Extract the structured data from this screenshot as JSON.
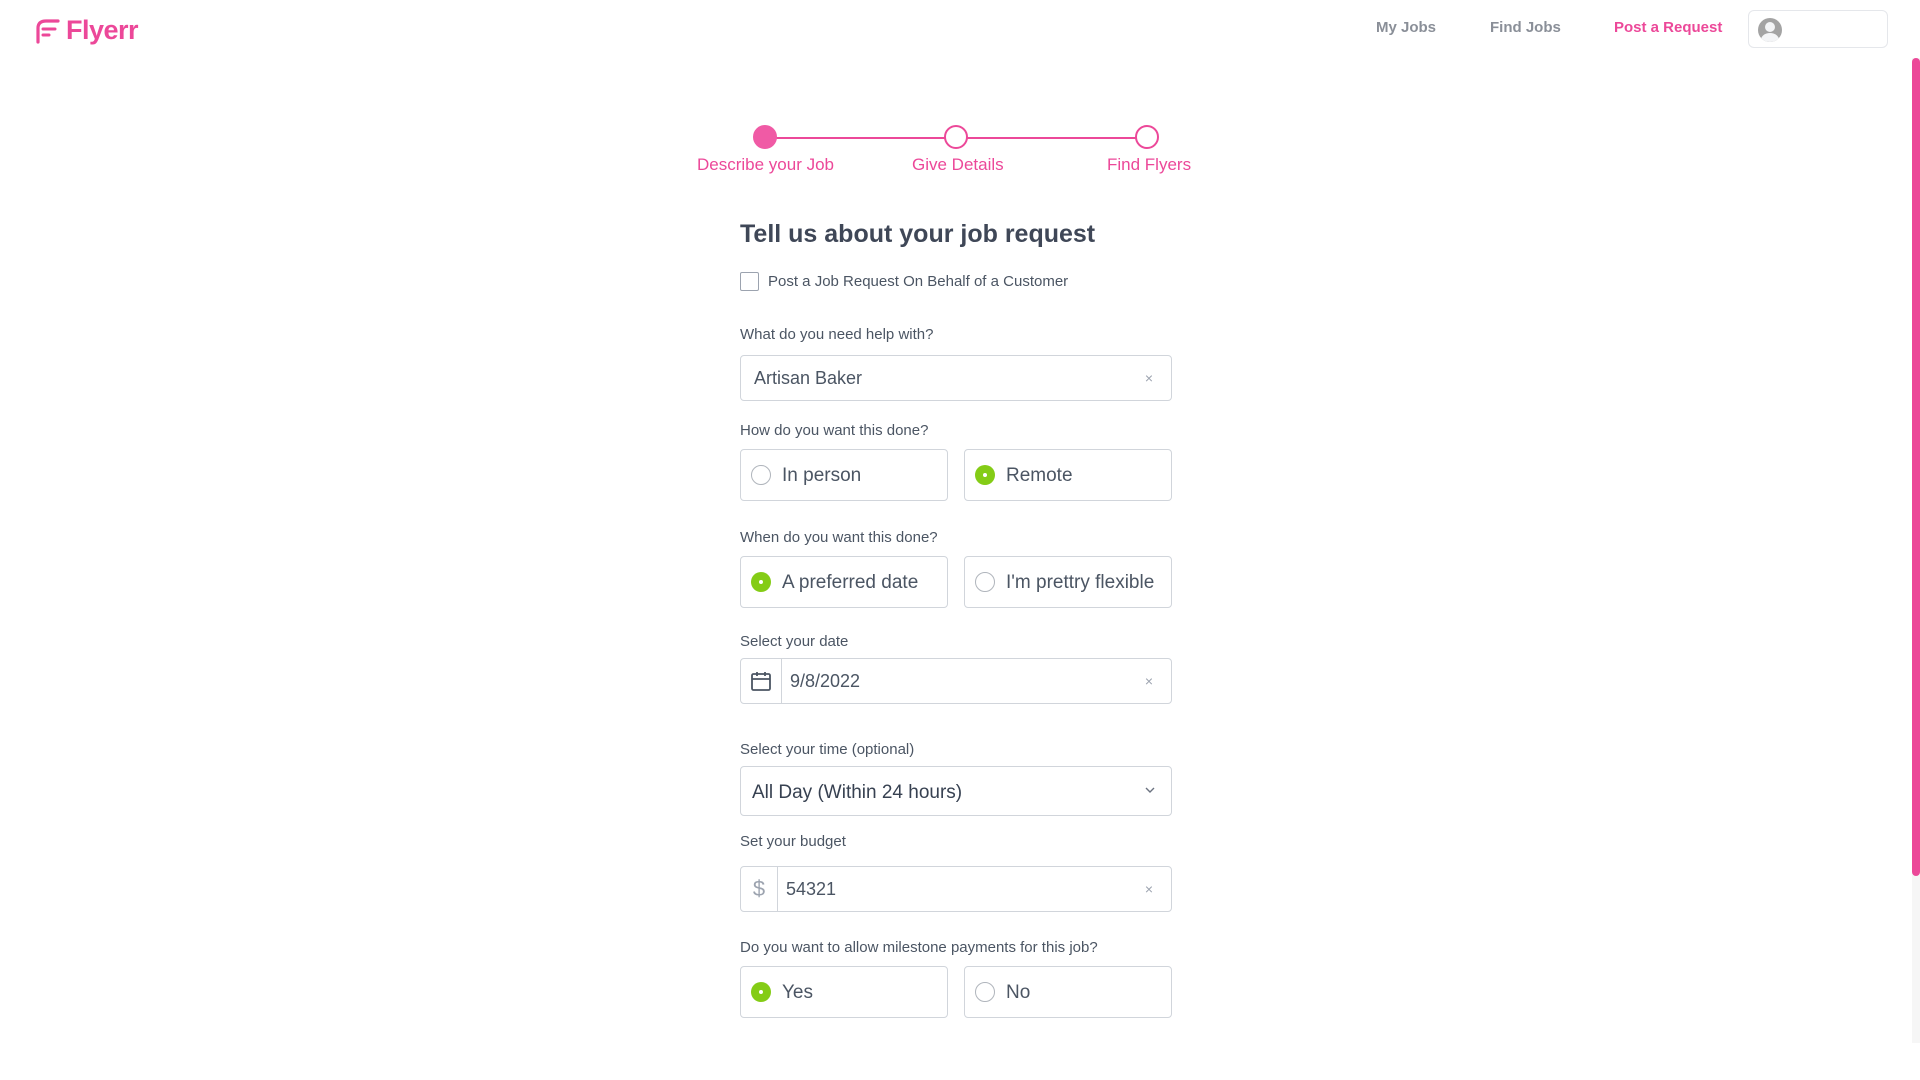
{
  "brand": {
    "name": "Flyerr",
    "color": "#ec4899"
  },
  "nav": {
    "my_jobs": "My Jobs",
    "find_jobs": "Find Jobs",
    "post_request": "Post a Request"
  },
  "steps": [
    {
      "label": "Describe your Job",
      "state": "active"
    },
    {
      "label": "Give Details",
      "state": "pending"
    },
    {
      "label": "Find Flyers",
      "state": "pending"
    }
  ],
  "form": {
    "title": "Tell us about your job request",
    "on_behalf": {
      "label": "Post a Job Request On Behalf of a Customer",
      "checked": false
    },
    "help_with": {
      "label": "What do you need help with?",
      "value": "Artisan Baker",
      "clear_icon": "×"
    },
    "how": {
      "label": "How do you want this done?",
      "options": [
        "In person",
        "Remote"
      ],
      "selected": "Remote"
    },
    "when": {
      "label": "When do you want this done?",
      "options": [
        "A preferred date",
        "I'm prettry flexible"
      ],
      "selected": "A preferred date"
    },
    "date": {
      "label": "Select your date",
      "value": "9/8/2022",
      "clear_icon": "×"
    },
    "time": {
      "label": "Select your time (optional)",
      "value": "All Day (Within 24 hours)"
    },
    "budget": {
      "label": "Set your budget",
      "currency": "$",
      "value": "54321",
      "clear_icon": "×"
    },
    "milestone": {
      "label": "Do you want to allow milestone payments for this job?",
      "options": [
        "Yes",
        "No"
      ],
      "selected": "Yes"
    }
  },
  "colors": {
    "accent": "#ec4899",
    "radio_checked": "#84cc16",
    "text": "#4b5563"
  }
}
